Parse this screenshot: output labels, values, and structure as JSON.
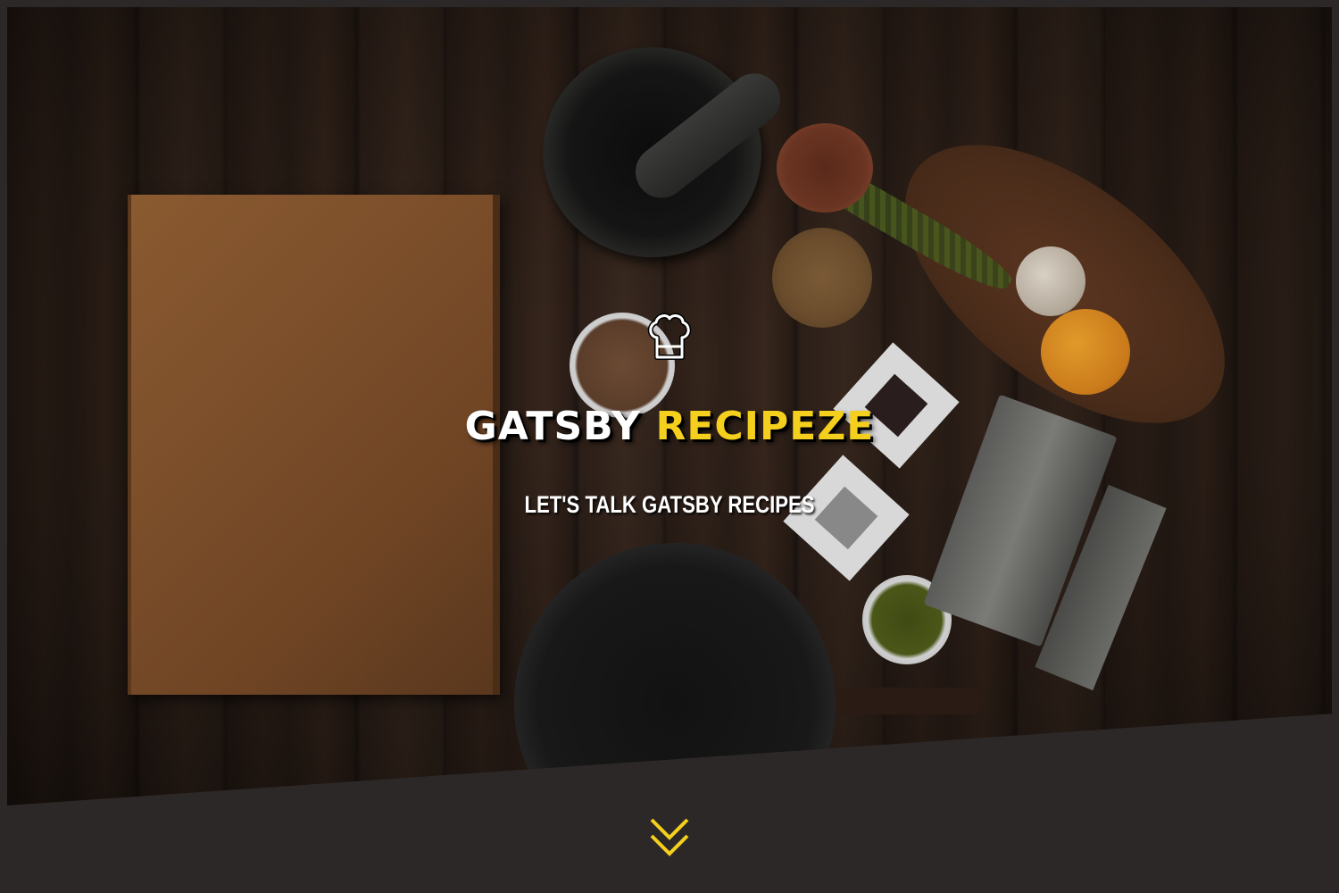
{
  "hero": {
    "title_part1": "GATSBY",
    "title_part2": "RECIPEZE",
    "subtitle": "LET'S TALK GATSBY RECIPES"
  },
  "icons": {
    "logo": "chef-hat-icon",
    "scroll": "double-chevron-down-icon"
  },
  "colors": {
    "accent": "#f5cf1d",
    "background": "#2c2827",
    "title": "#ffffff"
  }
}
